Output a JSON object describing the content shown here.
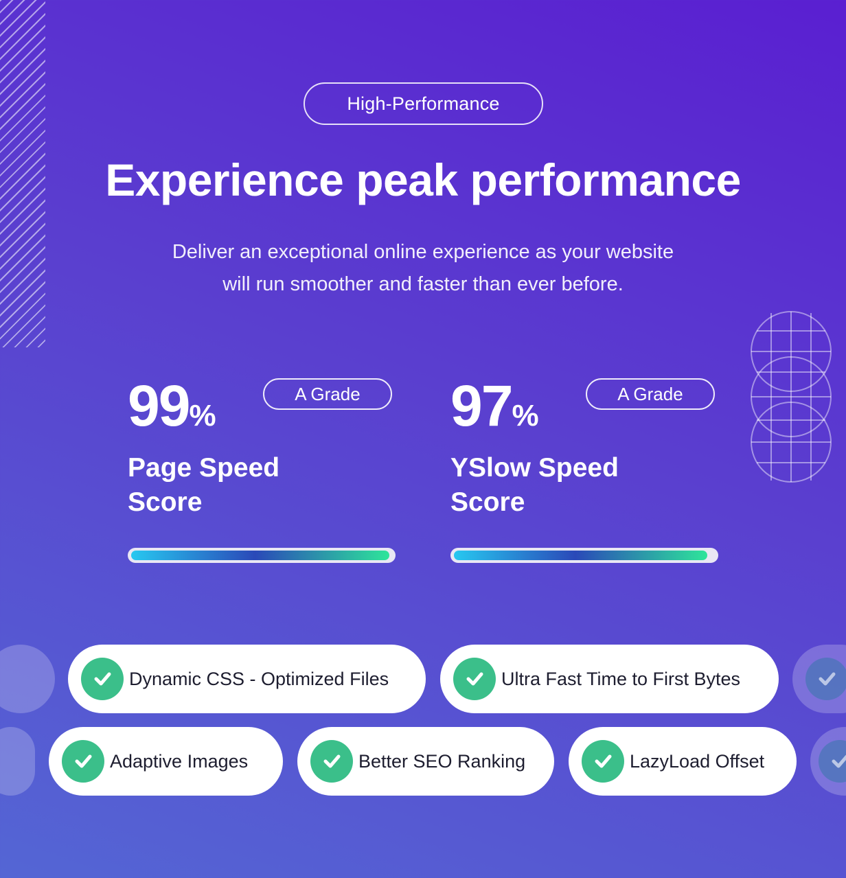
{
  "hero": {
    "eyebrow": "High-Performance",
    "title": "Experience peak performance",
    "subtitle_line1": "Deliver an exceptional online experience as your website",
    "subtitle_line2": "will run smoother and faster than ever before."
  },
  "metrics": [
    {
      "value": "99",
      "unit": "%",
      "grade": "A Grade",
      "label_line1": "Page Speed",
      "label_line2": "Score",
      "progress": 0.99
    },
    {
      "value": "97",
      "unit": "%",
      "grade": "A Grade",
      "label_line1": "YSlow Speed",
      "label_line2": "Score",
      "progress": 0.97
    }
  ],
  "features": [
    "Dynamic CSS - Optimized Files",
    "Ultra Fast Time to First Bytes",
    "Adaptive Images",
    "Better SEO Ranking",
    "LazyLoad Offset"
  ],
  "icons": {
    "feature_check": "check-circle-icon",
    "decor_globe": "globe-grid-icon",
    "decor_stripes": "diagonal-stripes"
  },
  "colors": {
    "check_green": "#3bbf8a",
    "progress_start": "#27c8f0",
    "progress_mid": "#2a49b8",
    "progress_end": "#2ee59a"
  }
}
